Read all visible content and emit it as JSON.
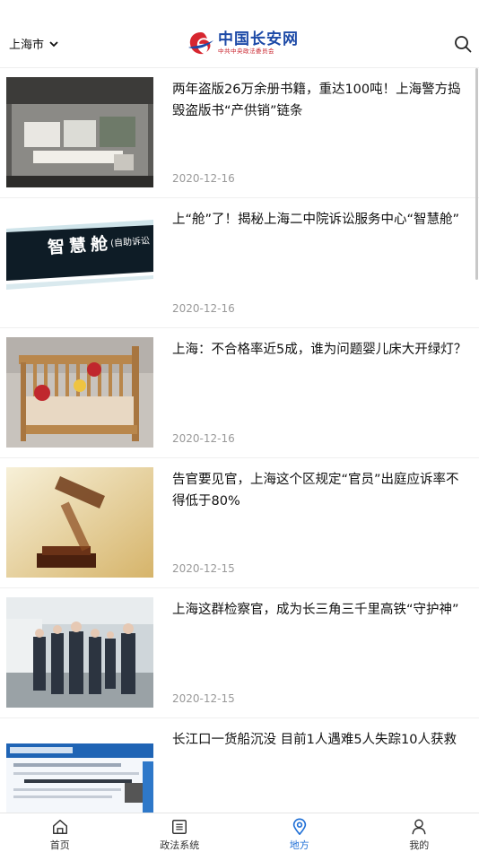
{
  "header": {
    "city": "上海市",
    "logo_main": "中国长安网",
    "logo_sub": "中共中央政法委员会"
  },
  "news": [
    {
      "title": "两年盗版26万余册书籍，重达100吨！上海警方捣毁盗版书“产供销”链条",
      "date": "2020-12-16"
    },
    {
      "title": "上“舱”了！揭秘上海二中院诉讼服务中心“智慧舱”",
      "date": "2020-12-16",
      "image_text": "智慧舱",
      "image_subtext": "(自助诉讼"
    },
    {
      "title": "上海：不合格率近5成，谁为问题婴儿床大开绿灯？",
      "date": "2020-12-16"
    },
    {
      "title": "告官要见官，上海这个区规定“官员”出庭应诉率不得低于80%",
      "date": "2020-12-15"
    },
    {
      "title": "上海这群检察官，成为长三角三千里高铁“守护神”",
      "date": "2020-12-15"
    },
    {
      "title": "长江口一货船沉没 目前1人遇难5人失踪10人获救",
      "date": ""
    }
  ],
  "tabbar": {
    "items": [
      {
        "label": "首页",
        "icon": "home-icon"
      },
      {
        "label": "政法系统",
        "icon": "list-icon"
      },
      {
        "label": "地方",
        "icon": "location-pin-icon",
        "active": true
      },
      {
        "label": "我的",
        "icon": "user-icon"
      }
    ]
  },
  "colors": {
    "accent": "#1f6fd6",
    "logo_blue": "#1d4aa7",
    "logo_red": "#d7262f"
  }
}
